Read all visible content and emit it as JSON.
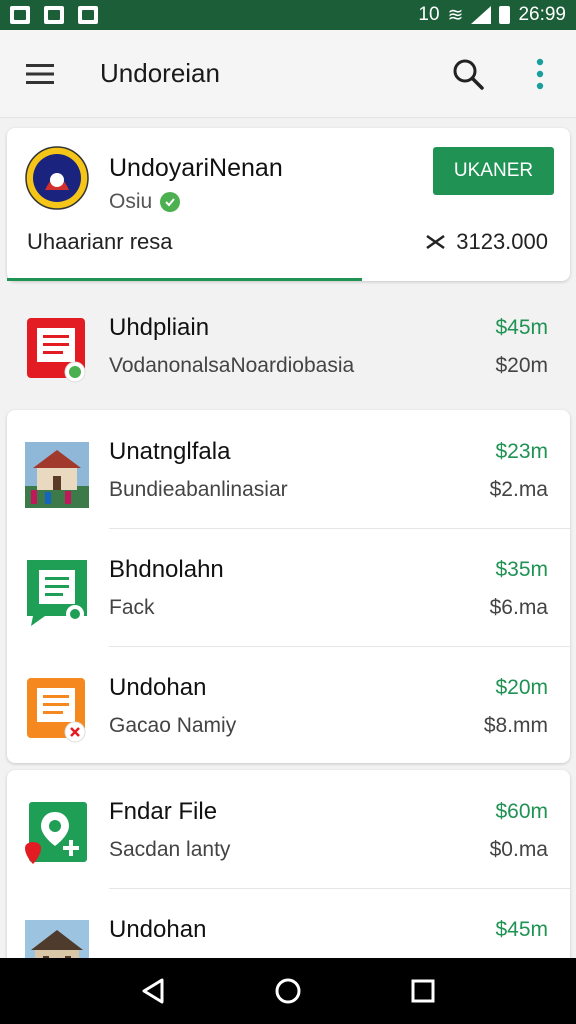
{
  "status_bar": {
    "time": "26:99",
    "network": "10"
  },
  "app_bar": {
    "title": "Undoreian"
  },
  "header": {
    "title": "UndoyariNenan",
    "subtitle": "Osiu",
    "button_label": "UKANER",
    "meta_label": "Uhaarianr resa",
    "amount": "3123.000"
  },
  "items": [
    {
      "title": "Uhdpliain",
      "subtitle": "VodanonalsaNoardiobasia",
      "price_primary": "$45m",
      "price_secondary": "$20m",
      "icon": "document-icon"
    },
    {
      "title": "Unatnglfala",
      "subtitle": "Bundieabanlinasiar",
      "price_primary": "$23m",
      "price_secondary": "$2.ma",
      "icon": "building-photo-icon"
    },
    {
      "title": "Bhdnolahn",
      "subtitle": "Fack",
      "price_primary": "$35m",
      "price_secondary": "$6.ma",
      "icon": "message-icon"
    },
    {
      "title": "Undohan",
      "subtitle": "Gacao Namiy",
      "price_primary": "$20m",
      "price_secondary": "$8.mm",
      "icon": "orange-document-icon"
    },
    {
      "title": "Fndar File",
      "subtitle": "Sacdan lanty",
      "price_primary": "$60m",
      "price_secondary": "$0.ma",
      "icon": "map-pin-icon"
    },
    {
      "title": "Undohan",
      "subtitle": "",
      "price_primary": "$45m",
      "price_secondary": "",
      "icon": "house-photo-icon"
    }
  ],
  "colors": {
    "primary": "#1f9254",
    "status_bar": "#1b5e38",
    "price": "#1f9254"
  }
}
